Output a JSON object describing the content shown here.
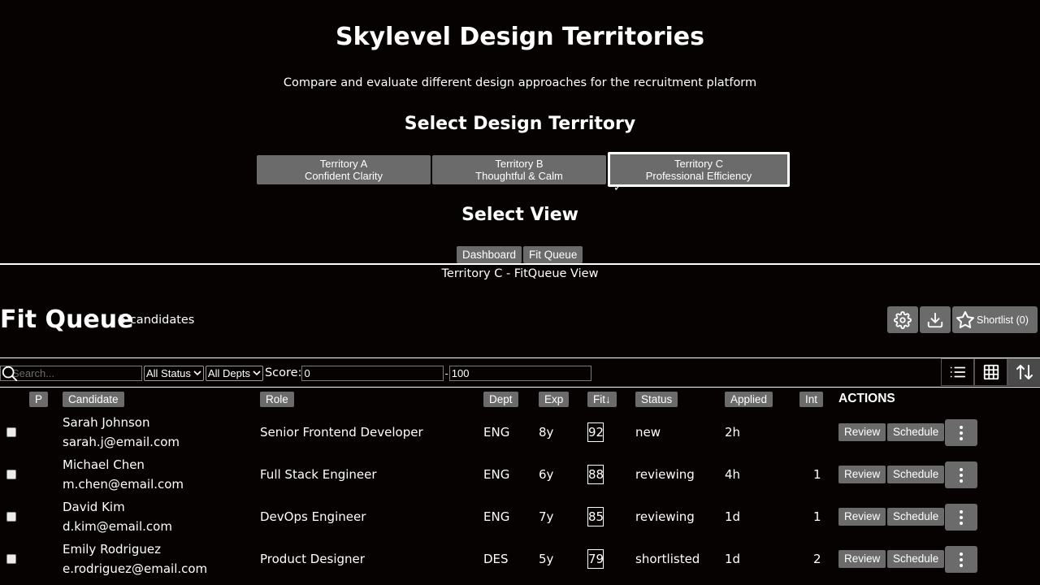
{
  "header": {
    "title": "Skylevel Design Territories",
    "subtitle": "Compare and evaluate different design approaches for the recruitment platform",
    "territory_heading": "Select Design Territory",
    "view_heading": "Select View"
  },
  "territories": [
    {
      "name": "Territory A",
      "desc": "Confident Clarity"
    },
    {
      "name": "Territory B",
      "desc": "Thoughtful & Calm"
    },
    {
      "name": "Territory C",
      "desc": "Professional Efficiency",
      "selected": true
    }
  ],
  "selected_mark": "✓",
  "views": [
    "Dashboard",
    "Fit Queue"
  ],
  "view_caption": "Territory C - FitQueue View",
  "queue": {
    "title": "Fit Queue",
    "count": "5 candidates",
    "shortlist_label": "Shortlist (0)"
  },
  "filters": {
    "search_placeholder": "Search...",
    "status": "All Status",
    "dept": "All Depts",
    "score_label": "Score:",
    "score_min": "0",
    "score_sep": "-",
    "score_max": "100"
  },
  "columns": {
    "p": "P",
    "candidate": "Candidate",
    "role": "Role",
    "dept": "Dept",
    "exp": "Exp",
    "fit": "Fit↓",
    "status": "Status",
    "applied": "Applied",
    "int": "Int",
    "actions": "ACTIONS"
  },
  "row_actions": {
    "review": "Review",
    "schedule": "Schedule"
  },
  "candidates": [
    {
      "name": "Sarah Johnson",
      "email": "sarah.j@email.com",
      "role": "Senior Frontend Developer",
      "dept": "ENG",
      "exp": "8y",
      "fit": "92",
      "status": "new",
      "applied": "2h",
      "int": ""
    },
    {
      "name": "Michael Chen",
      "email": "m.chen@email.com",
      "role": "Full Stack Engineer",
      "dept": "ENG",
      "exp": "6y",
      "fit": "88",
      "status": "reviewing",
      "applied": "4h",
      "int": "1"
    },
    {
      "name": "David Kim",
      "email": "d.kim@email.com",
      "role": "DevOps Engineer",
      "dept": "ENG",
      "exp": "7y",
      "fit": "85",
      "status": "reviewing",
      "applied": "1d",
      "int": "1"
    },
    {
      "name": "Emily Rodriguez",
      "email": "e.rodriguez@email.com",
      "role": "Product Designer",
      "dept": "DES",
      "exp": "5y",
      "fit": "79",
      "status": "shortlisted",
      "applied": "1d",
      "int": "2"
    }
  ],
  "icons": {
    "settings": "gear-icon",
    "download": "download-icon",
    "shortlist": "star-icon",
    "search": "search-icon",
    "list_view": "list-icon",
    "grid_view": "grid-icon",
    "sort": "sort-icon",
    "more": "more-vertical-icon"
  },
  "colors": {
    "background": "#060202",
    "button": "#6b6b6b",
    "text": "#ffffff"
  }
}
